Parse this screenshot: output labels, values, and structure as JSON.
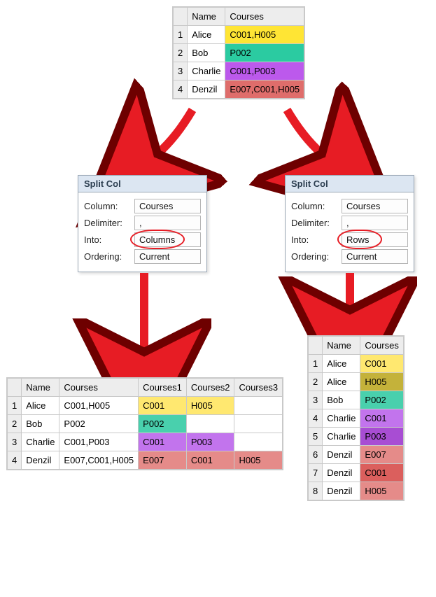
{
  "source_table": {
    "headers": [
      "Name",
      "Courses"
    ],
    "rows": [
      {
        "n": 1,
        "name": "Alice",
        "courses": "C001,H005",
        "hl": "hl-yellow"
      },
      {
        "n": 2,
        "name": "Bob",
        "courses": "P002",
        "hl": "hl-teal"
      },
      {
        "n": 3,
        "name": "Charlie",
        "courses": "C001,P003",
        "hl": "hl-purple"
      },
      {
        "n": 4,
        "name": "Denzil",
        "courses": "E007,C001,H005",
        "hl": "hl-pink"
      }
    ]
  },
  "panel_left": {
    "title": "Split Col",
    "column_label": "Column:",
    "column_value": "Courses",
    "delim_label": "Delimiter:",
    "delim_value": ",",
    "into_label": "Into:",
    "into_value": "Columns",
    "order_label": "Ordering:",
    "order_value": "Current"
  },
  "panel_right": {
    "title": "Split Col",
    "column_label": "Column:",
    "column_value": "Courses",
    "delim_label": "Delimiter:",
    "delim_value": ",",
    "into_label": "Into:",
    "into_value": "Rows",
    "order_label": "Ordering:",
    "order_value": "Current"
  },
  "result_cols": {
    "headers": [
      "Name",
      "Courses",
      "Courses1",
      "Courses2",
      "Courses3"
    ],
    "rows": [
      {
        "n": 1,
        "name": "Alice",
        "courses": "C001,H005",
        "c1": "C001",
        "c2": "H005",
        "c3": "",
        "hl": "yellow"
      },
      {
        "n": 2,
        "name": "Bob",
        "courses": "P002",
        "c1": "P002",
        "c2": "",
        "c3": "",
        "hl": "teal"
      },
      {
        "n": 3,
        "name": "Charlie",
        "courses": "C001,P003",
        "c1": "C001",
        "c2": "P003",
        "c3": "",
        "hl": "purple"
      },
      {
        "n": 4,
        "name": "Denzil",
        "courses": "E007,C001,H005",
        "c1": "E007",
        "c2": "C001",
        "c3": "H005",
        "hl": "pink"
      }
    ]
  },
  "result_rows": {
    "headers": [
      "Name",
      "Courses"
    ],
    "rows": [
      {
        "n": 1,
        "name": "Alice",
        "courses": "C001",
        "hl": "hl-yellow-a"
      },
      {
        "n": 2,
        "name": "Alice",
        "courses": "H005",
        "hl": "hl-yellow-b"
      },
      {
        "n": 3,
        "name": "Bob",
        "courses": "P002",
        "hl": "hl-teal-a"
      },
      {
        "n": 4,
        "name": "Charlie",
        "courses": "C001",
        "hl": "hl-purple-a"
      },
      {
        "n": 5,
        "name": "Charlie",
        "courses": "P003",
        "hl": "hl-purple-b"
      },
      {
        "n": 6,
        "name": "Denzil",
        "courses": "E007",
        "hl": "hl-pink-a"
      },
      {
        "n": 7,
        "name": "Denzil",
        "courses": "C001",
        "hl": "hl-pink-b"
      },
      {
        "n": 8,
        "name": "Denzil",
        "courses": "H005",
        "hl": "hl-pink-a"
      }
    ]
  }
}
